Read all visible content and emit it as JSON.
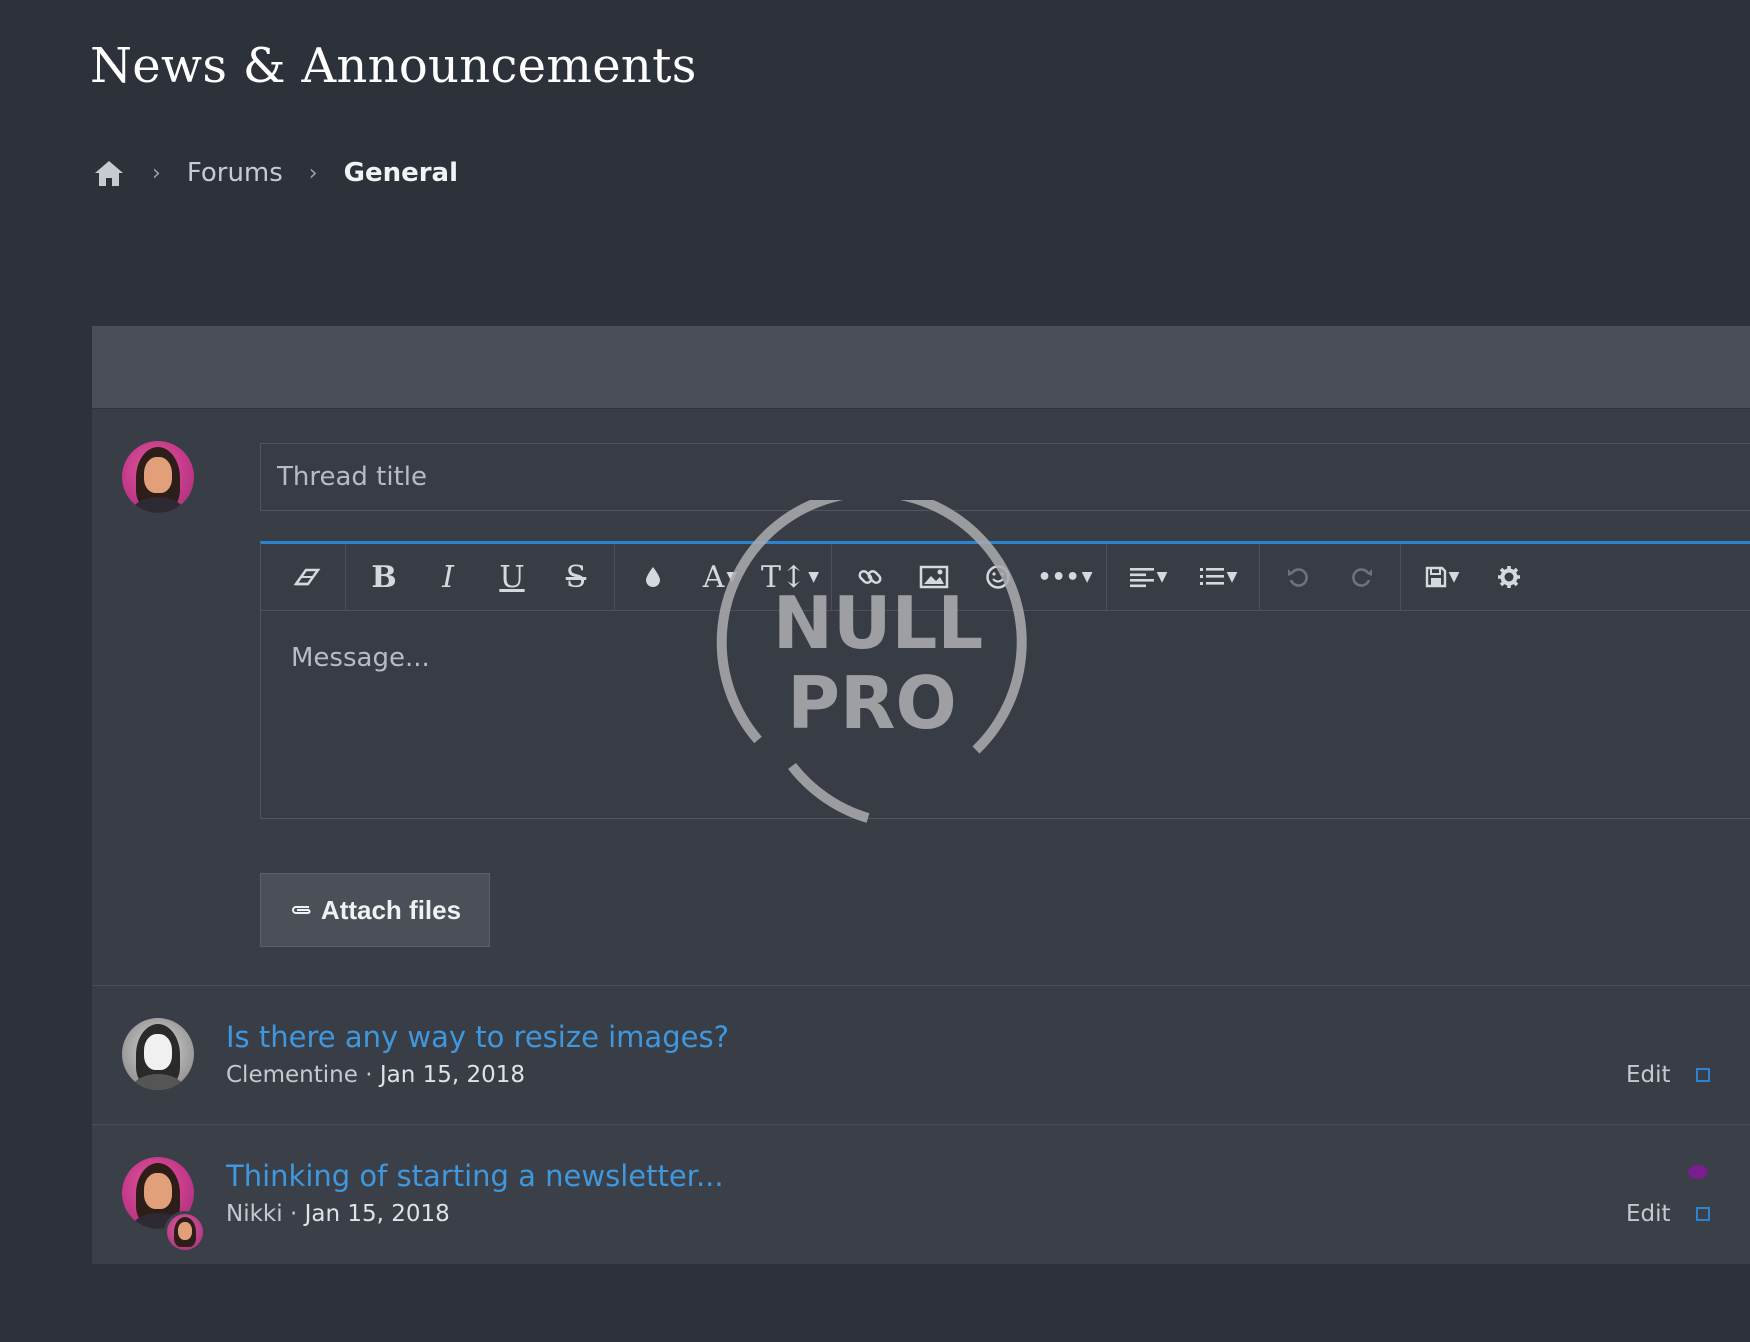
{
  "page": {
    "title": "News & Announcements"
  },
  "breadcrumb": {
    "home_icon": "home-icon",
    "items": [
      "Forums",
      "General"
    ]
  },
  "composer": {
    "title_placeholder": "Thread title",
    "message_placeholder": "Message...",
    "attach_label": "Attach files",
    "toolbar_icons": [
      "eraser-icon",
      "bold-icon",
      "italic-icon",
      "underline-icon",
      "strikethrough-icon",
      "color-drop-icon",
      "font-family-icon",
      "font-size-icon",
      "link-icon",
      "image-icon",
      "smiley-icon",
      "more-icon",
      "align-icon",
      "list-icon",
      "undo-icon",
      "redo-icon",
      "save-draft-icon",
      "settings-gear-icon"
    ]
  },
  "watermark": {
    "line1": "NULL",
    "line2": "PRO"
  },
  "threads": [
    {
      "title": "Is there any way to resize images?",
      "author": "Clementine",
      "date": "Jan 15, 2018",
      "edit_label": "Edit"
    },
    {
      "title": "Thinking of starting a newsletter...",
      "author": "Nikki",
      "date": "Jan 15, 2018",
      "edit_label": "Edit",
      "unread": true
    }
  ],
  "colors": {
    "background": "#2c313a",
    "panel": "#393d45",
    "accent": "#2b83d2",
    "link": "#3f97dd",
    "unread": "#7a1e8f"
  }
}
